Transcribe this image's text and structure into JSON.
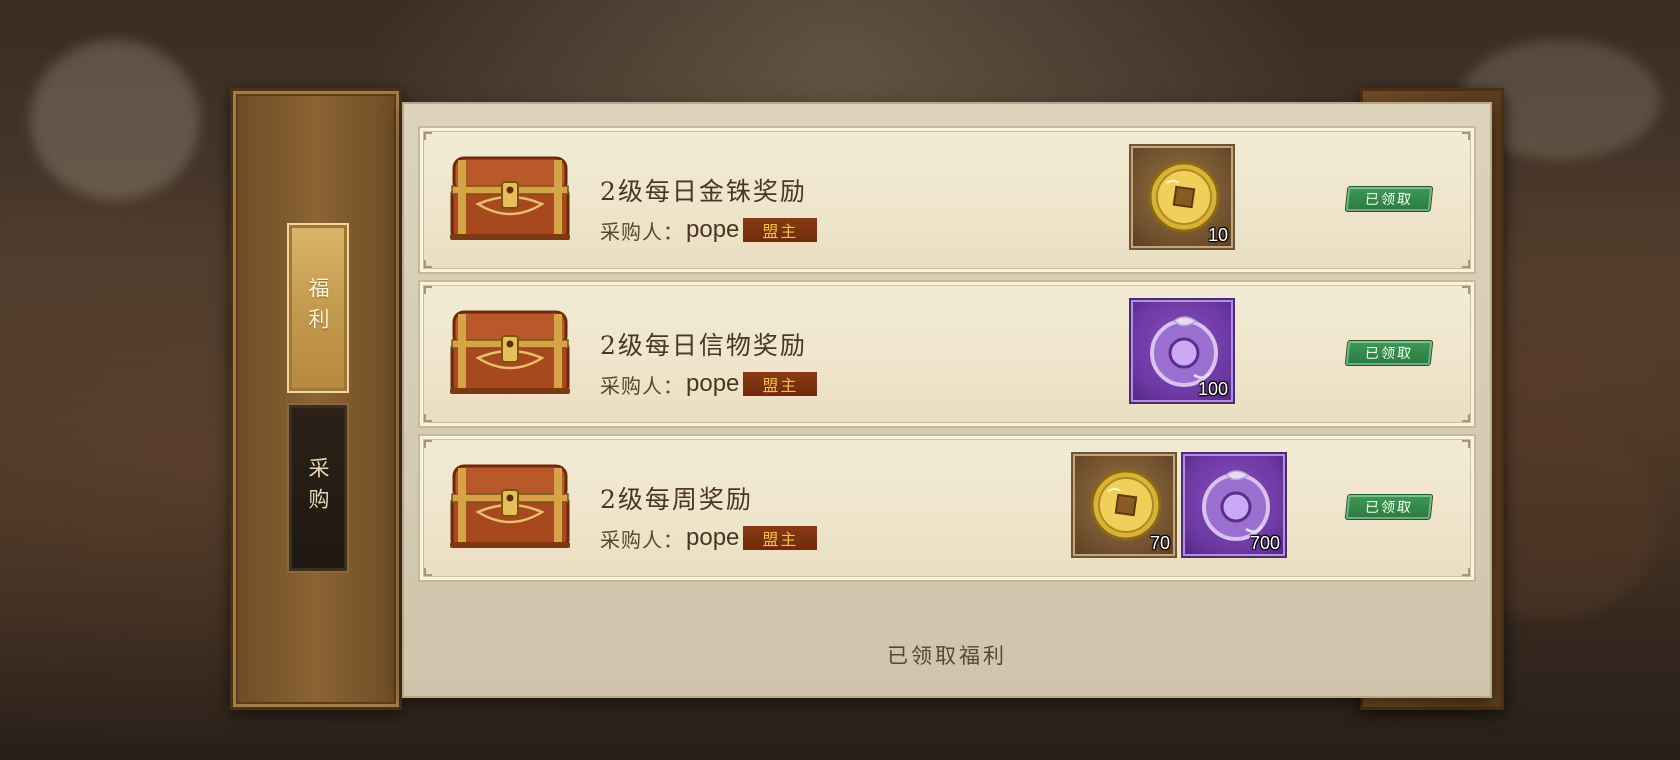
{
  "sidebar": {
    "tabs": [
      {
        "label": "福利",
        "active": true
      },
      {
        "label": "采购",
        "active": false
      }
    ]
  },
  "rewards": [
    {
      "title": "2级每日金铢奖励",
      "buyer_label": "采购人：",
      "buyer_name": "pope",
      "role": "盟主",
      "items": [
        {
          "icon": "gold-coin-icon",
          "count": "10"
        }
      ],
      "status": "已领取"
    },
    {
      "title": "2级每日信物奖励",
      "buyer_label": "采购人：",
      "buyer_name": "pope",
      "role": "盟主",
      "items": [
        {
          "icon": "purple-jade-token-icon",
          "count": "100"
        }
      ],
      "status": "已领取"
    },
    {
      "title": "2级每周奖励",
      "buyer_label": "采购人：",
      "buyer_name": "pope",
      "role": "盟主",
      "items": [
        {
          "icon": "gold-coin-icon",
          "count": "70"
        },
        {
          "icon": "purple-jade-token-icon",
          "count": "700"
        }
      ],
      "status": "已领取"
    }
  ],
  "footer": {
    "label": "已领取福利"
  },
  "colors": {
    "frame_brown": "#6e4b25",
    "parchment": "#efe5cc",
    "claimed_green": "#2c7a41",
    "role_badge": "#7a3110",
    "role_text": "#f0c04a"
  }
}
